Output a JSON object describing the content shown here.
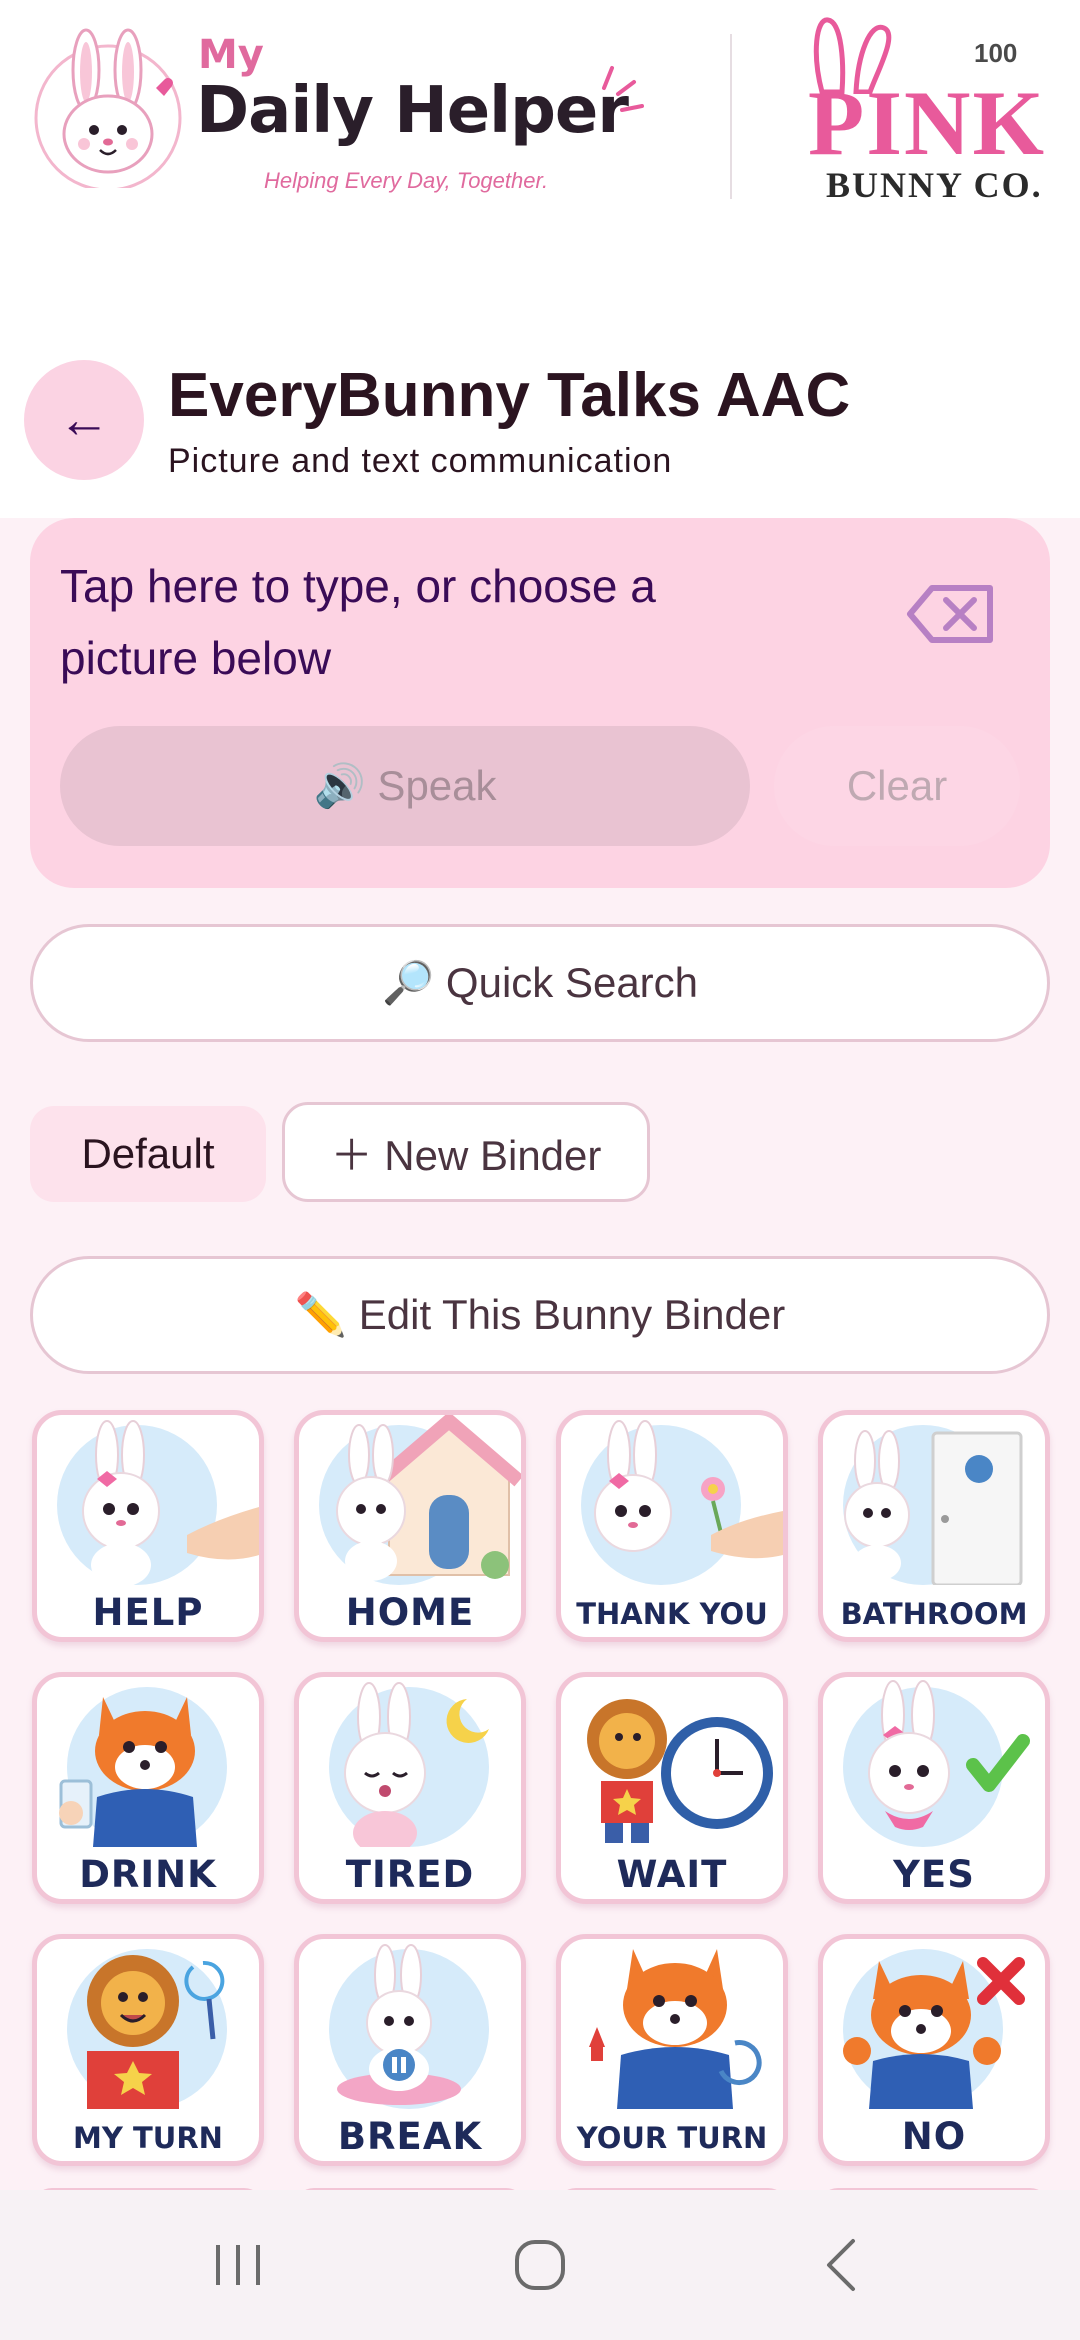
{
  "brand": {
    "my": "My",
    "title": "Daily Helper",
    "tagline": "Helping Every Day, Together.",
    "partner_number": "100",
    "partner_word": "PINK",
    "partner_sub": "BUNNY CO."
  },
  "header": {
    "title": "EveryBunny Talks AAC",
    "subtitle": "Picture and text communication",
    "back_icon": "←"
  },
  "compose": {
    "placeholder": "Tap here to type, or choose a picture below",
    "speak_label": "🔊 Speak",
    "clear_label": "Clear"
  },
  "quick_search_label": "🔎 Quick Search",
  "binders": {
    "default_label": "Default",
    "new_label": "＋ New Binder"
  },
  "edit_binder_label": "✏️ Edit This Bunny Binder",
  "tiles": [
    {
      "label": "HELP",
      "character": "bunny",
      "prop": "hand"
    },
    {
      "label": "HOME",
      "character": "bunny",
      "prop": "house"
    },
    {
      "label": "THANK YOU",
      "character": "bunny",
      "prop": "flower"
    },
    {
      "label": "BATHROOM",
      "character": "bunny",
      "prop": "door"
    },
    {
      "label": "DRINK",
      "character": "fox",
      "prop": "glass"
    },
    {
      "label": "TIRED",
      "character": "bunny",
      "prop": "moon"
    },
    {
      "label": "WAIT",
      "character": "lion",
      "prop": "clock"
    },
    {
      "label": "YES",
      "character": "bunny",
      "prop": "check"
    },
    {
      "label": "MY TURN",
      "character": "lion",
      "prop": "arrow"
    },
    {
      "label": "BREAK",
      "character": "bunny",
      "prop": "pause"
    },
    {
      "label": "YOUR TURN",
      "character": "fox",
      "prop": "arrow"
    },
    {
      "label": "NO",
      "character": "fox",
      "prop": "cross"
    }
  ],
  "colors": {
    "accent": "#fdd3e3",
    "ink": "#3a0b57",
    "tile_label": "#1e2a5a",
    "tile_border": "#f2c5d6"
  }
}
